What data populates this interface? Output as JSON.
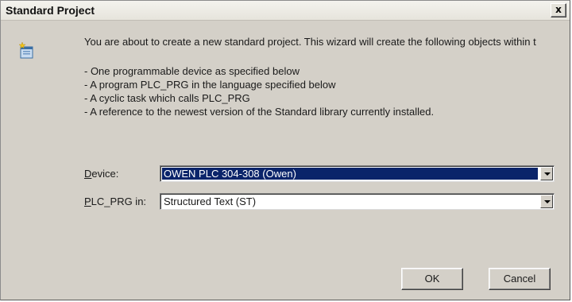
{
  "window": {
    "title": "Standard Project",
    "close_label": "x"
  },
  "intro_text": "You are about to create a new standard project. This wizard will create the following objects within t",
  "objects_list": [
    "- One programmable device as specified below",
    "- A program PLC_PRG in the language specified below",
    "- A cyclic task which calls PLC_PRG",
    "- A reference to the newest version of the Standard library currently installed."
  ],
  "form": {
    "device": {
      "label_underlined": "D",
      "label_rest": "evice:",
      "value": "OWEN PLC 304-308 (Owen)"
    },
    "plc_prg": {
      "label_underlined": "P",
      "label_rest": "LC_PRG in:",
      "value": "Structured Text (ST)"
    }
  },
  "buttons": {
    "ok": "OK",
    "cancel": "Cancel"
  },
  "colors": {
    "selection": "#0a246a",
    "dialog_bg": "#d4d0c8"
  }
}
